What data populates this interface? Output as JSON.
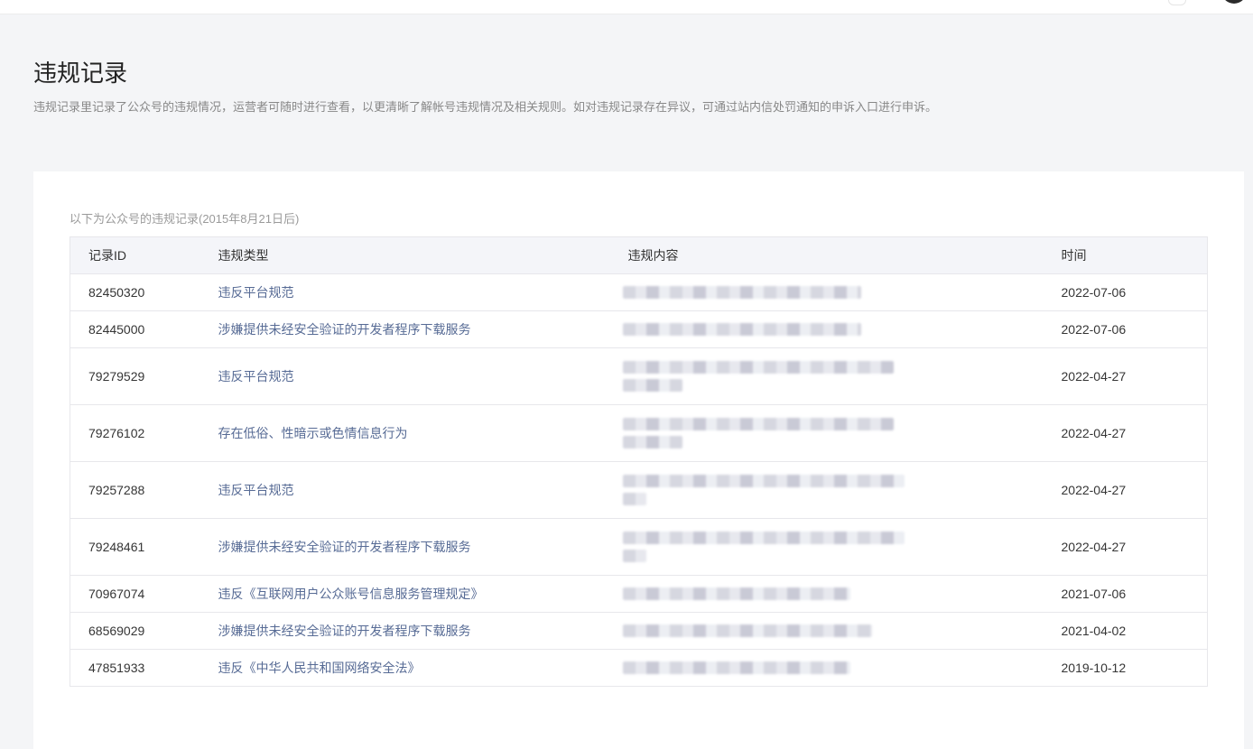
{
  "page": {
    "title": "违规记录",
    "description": "违规记录里记录了公众号的违规情况，运营者可随时进行查看，以更清晰了解帐号违规情况及相关规则。如对违规记录存在异议，可通过站内信处罚通知的申诉入口进行申诉。"
  },
  "records": {
    "caption": "以下为公众号的违规记录(2015年8月21日后)",
    "columns": [
      "记录ID",
      "违规类型",
      "违规内容",
      "时间"
    ],
    "rows": [
      {
        "id": "82450320",
        "type": "违反平台规范",
        "date": "2022-07-06"
      },
      {
        "id": "82445000",
        "type": "涉嫌提供未经安全验证的开发者程序下载服务",
        "date": "2022-07-06"
      },
      {
        "id": "79279529",
        "type": "违反平台规范",
        "date": "2022-04-27"
      },
      {
        "id": "79276102",
        "type": "存在低俗、性暗示或色情信息行为",
        "date": "2022-04-27"
      },
      {
        "id": "79257288",
        "type": "违反平台规范",
        "date": "2022-04-27"
      },
      {
        "id": "79248461",
        "type": "涉嫌提供未经安全验证的开发者程序下载服务",
        "date": "2022-04-27"
      },
      {
        "id": "70967074",
        "type": "违反《互联网用户公众账号信息服务管理规定》",
        "date": "2021-07-06"
      },
      {
        "id": "68569029",
        "type": "涉嫌提供未经安全验证的开发者程序下载服务",
        "date": "2021-04-02"
      },
      {
        "id": "47851933",
        "type": "违反《中华人民共和国网络安全法》",
        "date": "2019-10-12"
      }
    ]
  }
}
